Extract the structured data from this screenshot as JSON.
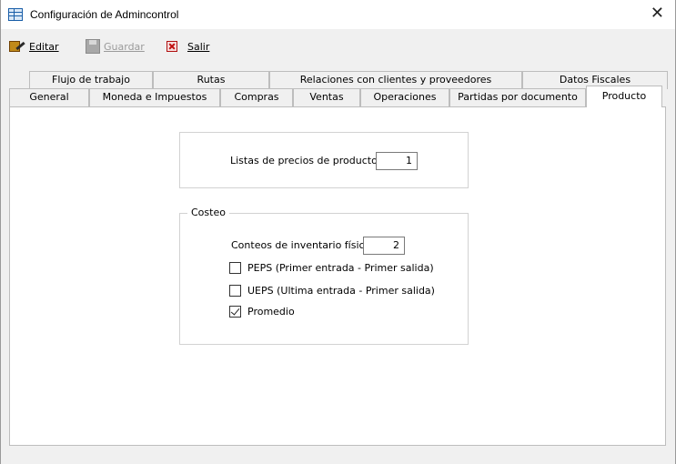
{
  "window": {
    "title": "Configuración de Admincontrol"
  },
  "toolbar": {
    "edit_label": "Editar",
    "save_label": "Guardar",
    "exit_label": "Salir"
  },
  "tabs_top": [
    "Flujo de trabajo",
    "Rutas",
    "Relaciones con clientes y proveedores",
    "Datos Fiscales"
  ],
  "tabs_bottom": [
    "General",
    "Moneda e Impuestos",
    "Compras",
    "Ventas",
    "Operaciones",
    "Partidas por documento",
    "Producto"
  ],
  "active_tab": "Producto",
  "price_lists": {
    "label": "Listas de precios de productos",
    "value": "1"
  },
  "costing": {
    "legend": "Costeo",
    "inventory_counts_label": "Conteos de inventario físico",
    "inventory_counts_value": "2",
    "options": [
      {
        "label": "PEPS (Primer entrada - Primer salida)",
        "checked": false
      },
      {
        "label": "UEPS (Ultima entrada - Primer salida)",
        "checked": false
      },
      {
        "label": "Promedio",
        "checked": true
      }
    ]
  }
}
